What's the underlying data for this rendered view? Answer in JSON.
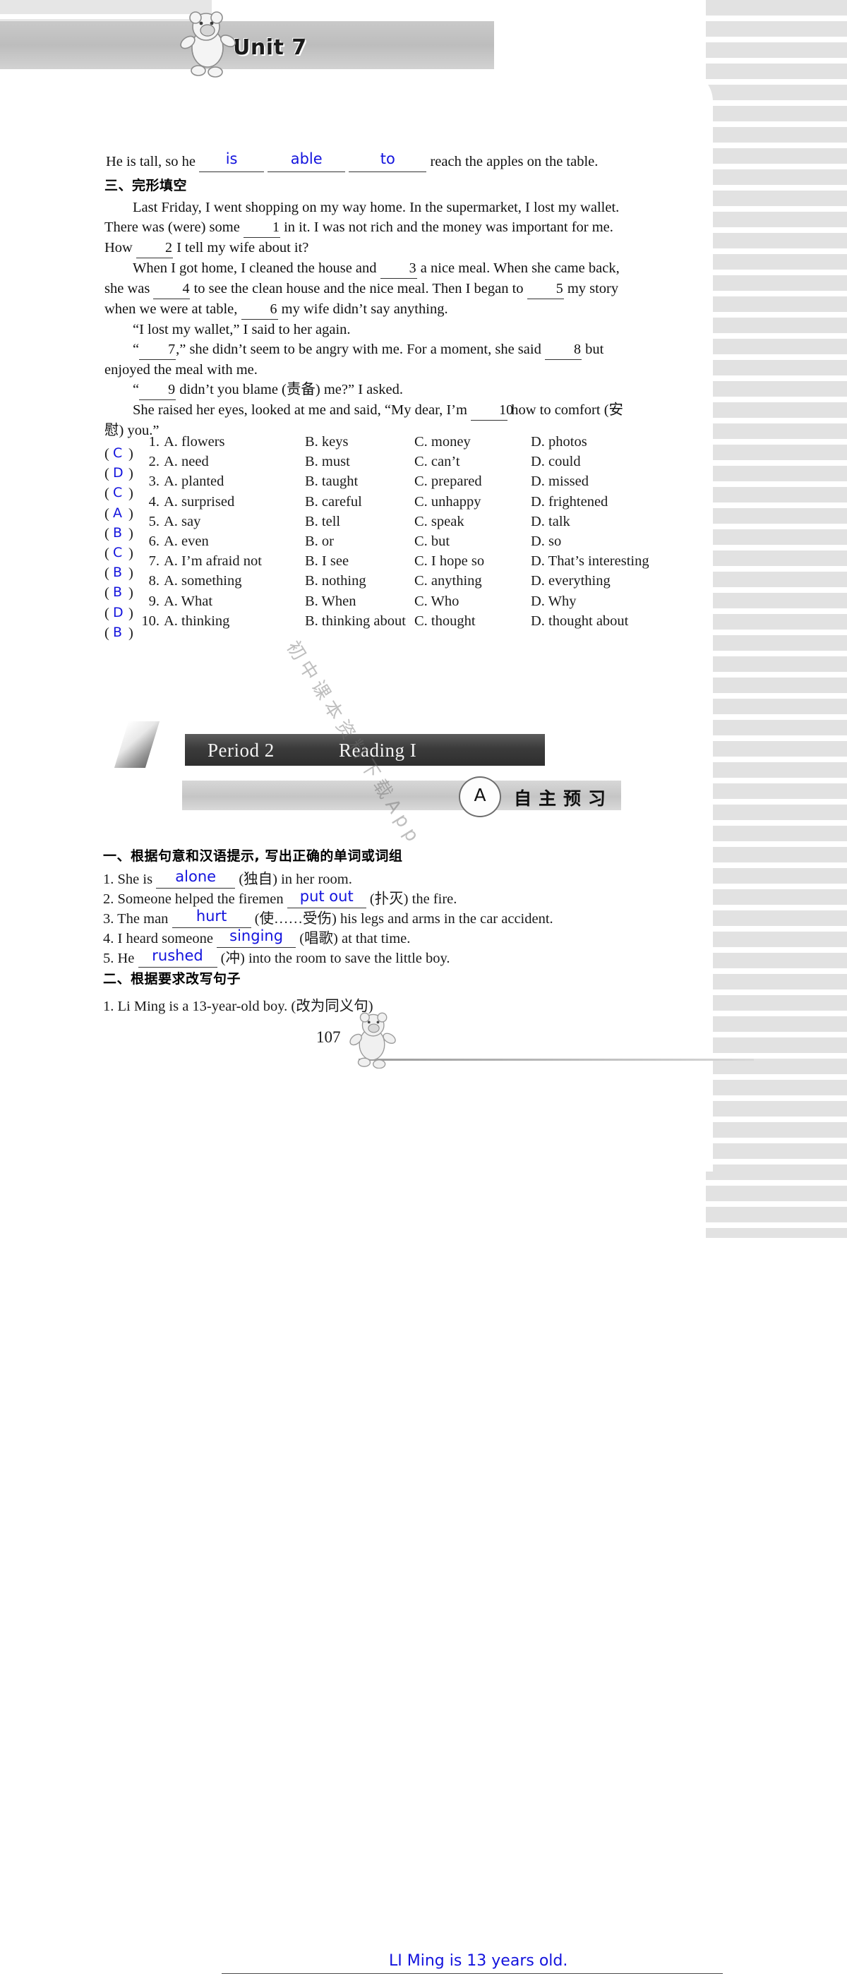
{
  "header": {
    "unit_title": "Unit 7",
    "mascot_icon": "bear-mascot-icon"
  },
  "watermark": "初中课本资料下载App",
  "top_exercise": {
    "prefix": "He is tall, so he",
    "answer1": "is",
    "answer2": "able",
    "answer3": "to",
    "suffix": "reach the apples on the table."
  },
  "section_three": {
    "heading": "三、完形填空",
    "paragraphs": [
      "Last Friday, I went shopping on my way home. In the supermarket, I lost my wallet. There was (were) some __1__ in it. I was not rich and the money was important for me. How __2__ I tell my wife about it?",
      "When I got home, I cleaned the house and __3__ a nice meal. When she came back, she was __4__ to see the clean house and the nice meal. Then I began to __5__ my story when we were at table, __6__ my wife didn’t say anything.",
      "“I lost my wallet,” I said to her again.",
      "“__7__,” she didn’t seem to be angry with me. For a moment, she said __8__ but enjoyed the meal with me.",
      "“__9__ didn’t you blame (责备) me?” I asked.",
      "She raised her eyes, looked at me and said, “My dear, I’m __10__ how to comfort (安慰) you.”"
    ],
    "questions": [
      {
        "n": "1.",
        "answer": "C",
        "A": "A. flowers",
        "B": "B. keys",
        "C": "C. money",
        "D": "D. photos"
      },
      {
        "n": "2.",
        "answer": "D",
        "A": "A. need",
        "B": "B. must",
        "C": "C. can’t",
        "D": "D. could"
      },
      {
        "n": "3.",
        "answer": "C",
        "A": "A. planted",
        "B": "B. taught",
        "C": "C. prepared",
        "D": "D. missed"
      },
      {
        "n": "4.",
        "answer": "A",
        "A": "A. surprised",
        "B": "B. careful",
        "C": "C. unhappy",
        "D": "D. frightened"
      },
      {
        "n": "5.",
        "answer": "B",
        "A": "A. say",
        "B": "B. tell",
        "C": "C. speak",
        "D": "D. talk"
      },
      {
        "n": "6.",
        "answer": "C",
        "A": "A. even",
        "B": "B. or",
        "C": "C. but",
        "D": "D. so"
      },
      {
        "n": "7.",
        "answer": "B",
        "A": "A. I’m afraid not",
        "B": "B. I see",
        "C": "C. I hope so",
        "D": "D. That’s interesting"
      },
      {
        "n": "8.",
        "answer": "B",
        "A": "A. something",
        "B": "B. nothing",
        "C": "C. anything",
        "D": "D. everything"
      },
      {
        "n": "9.",
        "answer": "D",
        "A": "A. What",
        "B": "B. When",
        "C": "C. Who",
        "D": "D. Why"
      },
      {
        "n": "10.",
        "answer": "B",
        "A": "A. thinking",
        "B": "B. thinking about",
        "C": "C. thought",
        "D": "D. thought about"
      }
    ]
  },
  "period_banner": {
    "period_label": "Period 2",
    "reading_label": "Reading I"
  },
  "preview_bar": {
    "badge": "A",
    "title": "自主预习"
  },
  "exercise_one": {
    "heading": "一、根据句意和汉语提示, 写出正确的单词或词组",
    "items": [
      {
        "num": "1.",
        "before": "She is",
        "answer": "alone",
        "hint": "(独自)",
        "after": "in her room."
      },
      {
        "num": "2.",
        "before": "Someone helped the firemen",
        "answer": "put out",
        "hint": "(扑灭)",
        "after": "the fire."
      },
      {
        "num": "3.",
        "before": "The man",
        "answer": "hurt",
        "hint": "(使……受伤)",
        "after": "his legs and arms in the car accident."
      },
      {
        "num": "4.",
        "before": "I heard someone",
        "answer": "singing",
        "hint": "(唱歌)",
        "after": "at that time."
      },
      {
        "num": "5.",
        "before": "He",
        "answer": "rushed",
        "hint": "(冲)",
        "after": "into the room to save the little boy."
      }
    ]
  },
  "exercise_two": {
    "heading": "二、根据要求改写句子",
    "question": "1. Li Ming is a 13-year-old boy. (改为同义句)",
    "answer": "LI Ming is 13 years old."
  },
  "footer": {
    "page_number": "107",
    "mascot_icon": "bear-mascot-icon"
  }
}
